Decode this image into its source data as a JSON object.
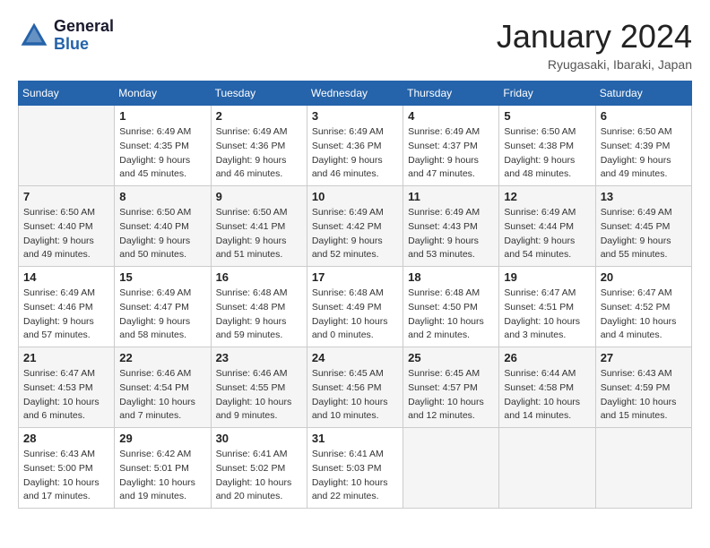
{
  "header": {
    "logo_general": "General",
    "logo_blue": "Blue",
    "month_title": "January 2024",
    "location": "Ryugasaki, Ibaraki, Japan"
  },
  "weekdays": [
    "Sunday",
    "Monday",
    "Tuesday",
    "Wednesday",
    "Thursday",
    "Friday",
    "Saturday"
  ],
  "weeks": [
    [
      {
        "day": "",
        "info": ""
      },
      {
        "day": "1",
        "info": "Sunrise: 6:49 AM\nSunset: 4:35 PM\nDaylight: 9 hours\nand 45 minutes."
      },
      {
        "day": "2",
        "info": "Sunrise: 6:49 AM\nSunset: 4:36 PM\nDaylight: 9 hours\nand 46 minutes."
      },
      {
        "day": "3",
        "info": "Sunrise: 6:49 AM\nSunset: 4:36 PM\nDaylight: 9 hours\nand 46 minutes."
      },
      {
        "day": "4",
        "info": "Sunrise: 6:49 AM\nSunset: 4:37 PM\nDaylight: 9 hours\nand 47 minutes."
      },
      {
        "day": "5",
        "info": "Sunrise: 6:50 AM\nSunset: 4:38 PM\nDaylight: 9 hours\nand 48 minutes."
      },
      {
        "day": "6",
        "info": "Sunrise: 6:50 AM\nSunset: 4:39 PM\nDaylight: 9 hours\nand 49 minutes."
      }
    ],
    [
      {
        "day": "7",
        "info": "Sunrise: 6:50 AM\nSunset: 4:40 PM\nDaylight: 9 hours\nand 49 minutes."
      },
      {
        "day": "8",
        "info": "Sunrise: 6:50 AM\nSunset: 4:40 PM\nDaylight: 9 hours\nand 50 minutes."
      },
      {
        "day": "9",
        "info": "Sunrise: 6:50 AM\nSunset: 4:41 PM\nDaylight: 9 hours\nand 51 minutes."
      },
      {
        "day": "10",
        "info": "Sunrise: 6:49 AM\nSunset: 4:42 PM\nDaylight: 9 hours\nand 52 minutes."
      },
      {
        "day": "11",
        "info": "Sunrise: 6:49 AM\nSunset: 4:43 PM\nDaylight: 9 hours\nand 53 minutes."
      },
      {
        "day": "12",
        "info": "Sunrise: 6:49 AM\nSunset: 4:44 PM\nDaylight: 9 hours\nand 54 minutes."
      },
      {
        "day": "13",
        "info": "Sunrise: 6:49 AM\nSunset: 4:45 PM\nDaylight: 9 hours\nand 55 minutes."
      }
    ],
    [
      {
        "day": "14",
        "info": "Sunrise: 6:49 AM\nSunset: 4:46 PM\nDaylight: 9 hours\nand 57 minutes."
      },
      {
        "day": "15",
        "info": "Sunrise: 6:49 AM\nSunset: 4:47 PM\nDaylight: 9 hours\nand 58 minutes."
      },
      {
        "day": "16",
        "info": "Sunrise: 6:48 AM\nSunset: 4:48 PM\nDaylight: 9 hours\nand 59 minutes."
      },
      {
        "day": "17",
        "info": "Sunrise: 6:48 AM\nSunset: 4:49 PM\nDaylight: 10 hours\nand 0 minutes."
      },
      {
        "day": "18",
        "info": "Sunrise: 6:48 AM\nSunset: 4:50 PM\nDaylight: 10 hours\nand 2 minutes."
      },
      {
        "day": "19",
        "info": "Sunrise: 6:47 AM\nSunset: 4:51 PM\nDaylight: 10 hours\nand 3 minutes."
      },
      {
        "day": "20",
        "info": "Sunrise: 6:47 AM\nSunset: 4:52 PM\nDaylight: 10 hours\nand 4 minutes."
      }
    ],
    [
      {
        "day": "21",
        "info": "Sunrise: 6:47 AM\nSunset: 4:53 PM\nDaylight: 10 hours\nand 6 minutes."
      },
      {
        "day": "22",
        "info": "Sunrise: 6:46 AM\nSunset: 4:54 PM\nDaylight: 10 hours\nand 7 minutes."
      },
      {
        "day": "23",
        "info": "Sunrise: 6:46 AM\nSunset: 4:55 PM\nDaylight: 10 hours\nand 9 minutes."
      },
      {
        "day": "24",
        "info": "Sunrise: 6:45 AM\nSunset: 4:56 PM\nDaylight: 10 hours\nand 10 minutes."
      },
      {
        "day": "25",
        "info": "Sunrise: 6:45 AM\nSunset: 4:57 PM\nDaylight: 10 hours\nand 12 minutes."
      },
      {
        "day": "26",
        "info": "Sunrise: 6:44 AM\nSunset: 4:58 PM\nDaylight: 10 hours\nand 14 minutes."
      },
      {
        "day": "27",
        "info": "Sunrise: 6:43 AM\nSunset: 4:59 PM\nDaylight: 10 hours\nand 15 minutes."
      }
    ],
    [
      {
        "day": "28",
        "info": "Sunrise: 6:43 AM\nSunset: 5:00 PM\nDaylight: 10 hours\nand 17 minutes."
      },
      {
        "day": "29",
        "info": "Sunrise: 6:42 AM\nSunset: 5:01 PM\nDaylight: 10 hours\nand 19 minutes."
      },
      {
        "day": "30",
        "info": "Sunrise: 6:41 AM\nSunset: 5:02 PM\nDaylight: 10 hours\nand 20 minutes."
      },
      {
        "day": "31",
        "info": "Sunrise: 6:41 AM\nSunset: 5:03 PM\nDaylight: 10 hours\nand 22 minutes."
      },
      {
        "day": "",
        "info": ""
      },
      {
        "day": "",
        "info": ""
      },
      {
        "day": "",
        "info": ""
      }
    ]
  ]
}
